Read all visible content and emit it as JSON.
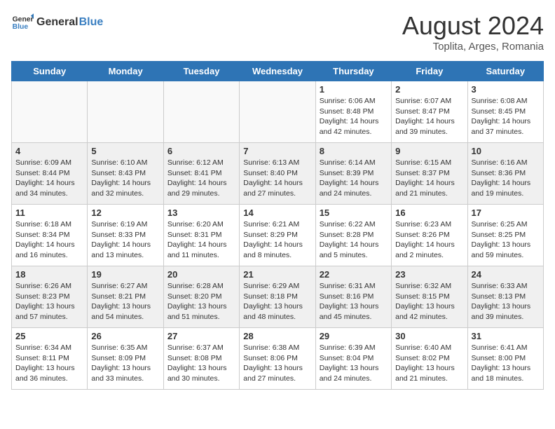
{
  "header": {
    "logo_general": "General",
    "logo_blue": "Blue",
    "title": "August 2024",
    "location": "Toplita, Arges, Romania"
  },
  "weekdays": [
    "Sunday",
    "Monday",
    "Tuesday",
    "Wednesday",
    "Thursday",
    "Friday",
    "Saturday"
  ],
  "weeks": [
    [
      {
        "day": "",
        "info": ""
      },
      {
        "day": "",
        "info": ""
      },
      {
        "day": "",
        "info": ""
      },
      {
        "day": "",
        "info": ""
      },
      {
        "day": "1",
        "info": "Sunrise: 6:06 AM\nSunset: 8:48 PM\nDaylight: 14 hours\nand 42 minutes."
      },
      {
        "day": "2",
        "info": "Sunrise: 6:07 AM\nSunset: 8:47 PM\nDaylight: 14 hours\nand 39 minutes."
      },
      {
        "day": "3",
        "info": "Sunrise: 6:08 AM\nSunset: 8:45 PM\nDaylight: 14 hours\nand 37 minutes."
      }
    ],
    [
      {
        "day": "4",
        "info": "Sunrise: 6:09 AM\nSunset: 8:44 PM\nDaylight: 14 hours\nand 34 minutes."
      },
      {
        "day": "5",
        "info": "Sunrise: 6:10 AM\nSunset: 8:43 PM\nDaylight: 14 hours\nand 32 minutes."
      },
      {
        "day": "6",
        "info": "Sunrise: 6:12 AM\nSunset: 8:41 PM\nDaylight: 14 hours\nand 29 minutes."
      },
      {
        "day": "7",
        "info": "Sunrise: 6:13 AM\nSunset: 8:40 PM\nDaylight: 14 hours\nand 27 minutes."
      },
      {
        "day": "8",
        "info": "Sunrise: 6:14 AM\nSunset: 8:39 PM\nDaylight: 14 hours\nand 24 minutes."
      },
      {
        "day": "9",
        "info": "Sunrise: 6:15 AM\nSunset: 8:37 PM\nDaylight: 14 hours\nand 21 minutes."
      },
      {
        "day": "10",
        "info": "Sunrise: 6:16 AM\nSunset: 8:36 PM\nDaylight: 14 hours\nand 19 minutes."
      }
    ],
    [
      {
        "day": "11",
        "info": "Sunrise: 6:18 AM\nSunset: 8:34 PM\nDaylight: 14 hours\nand 16 minutes."
      },
      {
        "day": "12",
        "info": "Sunrise: 6:19 AM\nSunset: 8:33 PM\nDaylight: 14 hours\nand 13 minutes."
      },
      {
        "day": "13",
        "info": "Sunrise: 6:20 AM\nSunset: 8:31 PM\nDaylight: 14 hours\nand 11 minutes."
      },
      {
        "day": "14",
        "info": "Sunrise: 6:21 AM\nSunset: 8:29 PM\nDaylight: 14 hours\nand 8 minutes."
      },
      {
        "day": "15",
        "info": "Sunrise: 6:22 AM\nSunset: 8:28 PM\nDaylight: 14 hours\nand 5 minutes."
      },
      {
        "day": "16",
        "info": "Sunrise: 6:23 AM\nSunset: 8:26 PM\nDaylight: 14 hours\nand 2 minutes."
      },
      {
        "day": "17",
        "info": "Sunrise: 6:25 AM\nSunset: 8:25 PM\nDaylight: 13 hours\nand 59 minutes."
      }
    ],
    [
      {
        "day": "18",
        "info": "Sunrise: 6:26 AM\nSunset: 8:23 PM\nDaylight: 13 hours\nand 57 minutes."
      },
      {
        "day": "19",
        "info": "Sunrise: 6:27 AM\nSunset: 8:21 PM\nDaylight: 13 hours\nand 54 minutes."
      },
      {
        "day": "20",
        "info": "Sunrise: 6:28 AM\nSunset: 8:20 PM\nDaylight: 13 hours\nand 51 minutes."
      },
      {
        "day": "21",
        "info": "Sunrise: 6:29 AM\nSunset: 8:18 PM\nDaylight: 13 hours\nand 48 minutes."
      },
      {
        "day": "22",
        "info": "Sunrise: 6:31 AM\nSunset: 8:16 PM\nDaylight: 13 hours\nand 45 minutes."
      },
      {
        "day": "23",
        "info": "Sunrise: 6:32 AM\nSunset: 8:15 PM\nDaylight: 13 hours\nand 42 minutes."
      },
      {
        "day": "24",
        "info": "Sunrise: 6:33 AM\nSunset: 8:13 PM\nDaylight: 13 hours\nand 39 minutes."
      }
    ],
    [
      {
        "day": "25",
        "info": "Sunrise: 6:34 AM\nSunset: 8:11 PM\nDaylight: 13 hours\nand 36 minutes."
      },
      {
        "day": "26",
        "info": "Sunrise: 6:35 AM\nSunset: 8:09 PM\nDaylight: 13 hours\nand 33 minutes."
      },
      {
        "day": "27",
        "info": "Sunrise: 6:37 AM\nSunset: 8:08 PM\nDaylight: 13 hours\nand 30 minutes."
      },
      {
        "day": "28",
        "info": "Sunrise: 6:38 AM\nSunset: 8:06 PM\nDaylight: 13 hours\nand 27 minutes."
      },
      {
        "day": "29",
        "info": "Sunrise: 6:39 AM\nSunset: 8:04 PM\nDaylight: 13 hours\nand 24 minutes."
      },
      {
        "day": "30",
        "info": "Sunrise: 6:40 AM\nSunset: 8:02 PM\nDaylight: 13 hours\nand 21 minutes."
      },
      {
        "day": "31",
        "info": "Sunrise: 6:41 AM\nSunset: 8:00 PM\nDaylight: 13 hours\nand 18 minutes."
      }
    ]
  ]
}
